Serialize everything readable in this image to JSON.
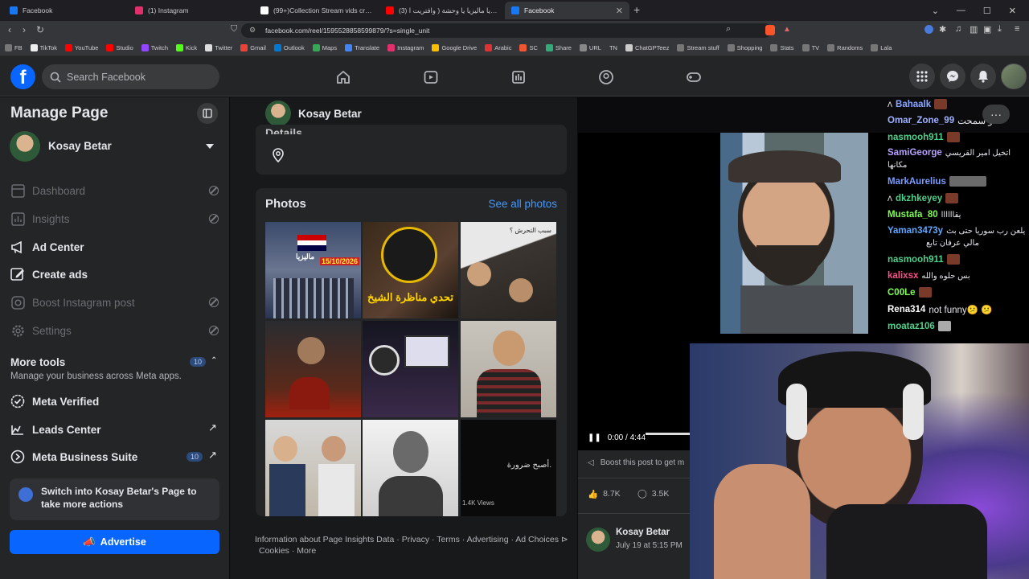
{
  "browser": {
    "tabs": [
      {
        "label": "Facebook",
        "color": "#1877f2",
        "active": false
      },
      {
        "label": "(1) Instagram",
        "color": "#e1306c",
        "active": false
      },
      {
        "label": "(99+)Collection Stream vids created",
        "color": "#ffffff",
        "active": false
      },
      {
        "label": "(3) اسئي يا ماليزيا يا وحشة ( وافتريت ا...",
        "color": "#ff0000",
        "active": false
      },
      {
        "label": "Facebook",
        "color": "#1877f2",
        "active": true
      }
    ],
    "url": "facebook.com/reel/1595528858599879/?s=single_unit",
    "bookmarks": [
      {
        "label": "FB",
        "color": "#888"
      },
      {
        "label": "TikTok",
        "color": "#eee"
      },
      {
        "label": "YouTube",
        "color": "#ff0000"
      },
      {
        "label": "Studio",
        "color": "#ff0000"
      },
      {
        "label": "Twitch",
        "color": "#9146ff"
      },
      {
        "label": "Kick",
        "color": "#53fc18"
      },
      {
        "label": "Twitter",
        "color": "#ddd"
      },
      {
        "label": "Gmail",
        "color": "#ea4335"
      },
      {
        "label": "Outlook",
        "color": "#0078d4"
      },
      {
        "label": "Maps",
        "color": "#34a853"
      },
      {
        "label": "Translate",
        "color": "#4285f4"
      },
      {
        "label": "Instagram",
        "color": "#e1306c"
      },
      {
        "label": "Google Drive",
        "color": "#fbbc04"
      },
      {
        "label": "Arabic",
        "color": "#d33"
      },
      {
        "label": "SC",
        "color": "#e53"
      },
      {
        "label": "Share",
        "color": "#3a7"
      },
      {
        "label": "URL",
        "color": "#888"
      },
      {
        "label": "TN",
        "color": "#888"
      },
      {
        "label": "ChatGPTeez",
        "color": "#ccc"
      },
      {
        "label": "Stream stuff",
        "color": "#888"
      },
      {
        "label": "Shopping",
        "color": "#888"
      },
      {
        "label": "Stats",
        "color": "#888"
      },
      {
        "label": "TV",
        "color": "#888"
      },
      {
        "label": "Randoms",
        "color": "#888"
      },
      {
        "label": "Lala",
        "color": "#888"
      }
    ]
  },
  "header": {
    "search_placeholder": "Search Facebook",
    "accent": "#0866ff"
  },
  "sidebar": {
    "title": "Manage Page",
    "page_name": "Kosay Betar",
    "items": [
      {
        "label": "Dashboard",
        "icon": "dashboard-icon",
        "enabled": false
      },
      {
        "label": "Insights",
        "icon": "insights-icon",
        "enabled": false
      },
      {
        "label": "Ad Center",
        "icon": "megaphone-icon",
        "enabled": true
      },
      {
        "label": "Create ads",
        "icon": "edit-icon",
        "enabled": true
      },
      {
        "label": "Boost Instagram post",
        "icon": "instagram-icon",
        "enabled": false
      },
      {
        "label": "Settings",
        "icon": "gear-icon",
        "enabled": false
      }
    ],
    "more_tools": {
      "title": "More tools",
      "count": "10",
      "subtitle": "Manage your business across Meta apps."
    },
    "tools": [
      {
        "label": "Meta Verified",
        "icon": "verified-icon"
      },
      {
        "label": "Leads Center",
        "icon": "leads-icon"
      },
      {
        "label": "Meta Business Suite",
        "icon": "meta-icon",
        "badge": "10"
      }
    ],
    "switch_text": "Switch into Kosay Betar's Page to take more actions",
    "advertise": "Advertise"
  },
  "center": {
    "page_name": "Kosay Betar",
    "details_label": "Details",
    "photos_title": "Photos",
    "see_all": "See all photos",
    "photo_texts": {
      "date": "15/10/2026",
      "country": "ماليزيا",
      "debate": "تحدي مناظرة الشيخ",
      "arabic_q": "سبب التحرش ؟",
      "views": "1.4K Views",
      "last_caption": "أصبح ضرورة."
    },
    "footer": "Information about Page Insights Data · Privacy · Terms · Advertising · Ad Choices",
    "footer2": "Cookies · More"
  },
  "reel": {
    "time": "0:00 / 4:44",
    "boost_text": "Boost this post to get m",
    "likes": "8.7K",
    "comments": "3.5K",
    "author": "Kosay Betar",
    "date": "July 19 at 5:15 PM"
  },
  "chat": [
    {
      "user": "Bahaalk",
      "color": "#8aa6ff",
      "msg": ""
    },
    {
      "user": "Omar_Zone_99",
      "color": "#9fb0ff",
      "msg": "لو سمحت"
    },
    {
      "user": "nasmooh911",
      "color": "#4fd18b",
      "msg": ""
    },
    {
      "user": "SamiGeorge",
      "color": "#b9a2ff",
      "msg": "اتخيل امير القريسي"
    },
    {
      "user": "",
      "color": "#e4e6eb",
      "msg": "مكانها"
    },
    {
      "user": "MarkAurelius",
      "color": "#7a9cff",
      "msg": ""
    },
    {
      "user": "dkzhkeyey",
      "color": "#4fd18b",
      "msg": ""
    },
    {
      "user": "Mustafa_80",
      "color": "#7cff4f",
      "msg": "يقاااااا"
    },
    {
      "user": "Yaman3473y",
      "color": "#5fa8ff",
      "msg": "يلعن رب سوريا حتى بث"
    },
    {
      "user": "",
      "color": "#e4e6eb",
      "msg": "مالي عرفان تابع"
    },
    {
      "user": "nasmooh911",
      "color": "#4fd18b",
      "msg": ""
    },
    {
      "user": "kalixsx",
      "color": "#ff4f8a",
      "msg": "بس حلوه والله"
    },
    {
      "user": "C00Le",
      "color": "#7cff4f",
      "msg": ""
    },
    {
      "user": "Rena314",
      "color": "#ffffff",
      "msg": "not funny😕 😕"
    },
    {
      "user": "moataz106",
      "color": "#4fd18b",
      "msg": ""
    }
  ]
}
